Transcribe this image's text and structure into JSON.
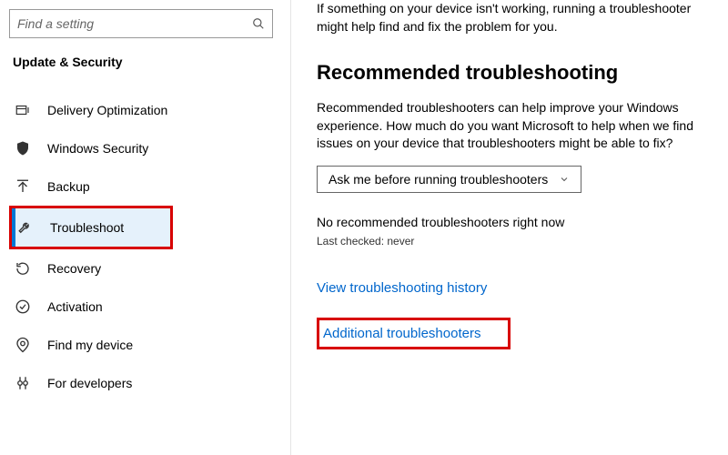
{
  "sidebar": {
    "search_placeholder": "Find a setting",
    "category": "Update & Security",
    "items": [
      {
        "label": "Delivery Optimization"
      },
      {
        "label": "Windows Security"
      },
      {
        "label": "Backup"
      },
      {
        "label": "Troubleshoot"
      },
      {
        "label": "Recovery"
      },
      {
        "label": "Activation"
      },
      {
        "label": "Find my device"
      },
      {
        "label": "For developers"
      }
    ]
  },
  "main": {
    "intro": "If something on your device isn't working, running a troubleshooter might help find and fix the problem for you.",
    "section_heading": "Recommended troubleshooting",
    "description": "Recommended troubleshooters can help improve your Windows experience. How much do you want Microsoft to help when we find issues on your device that troubleshooters might be able to fix?",
    "dropdown_value": "Ask me before running troubleshooters",
    "status": "No recommended troubleshooters right now",
    "last_checked": "Last checked: never",
    "link_history": "View troubleshooting history",
    "link_additional": "Additional troubleshooters"
  }
}
